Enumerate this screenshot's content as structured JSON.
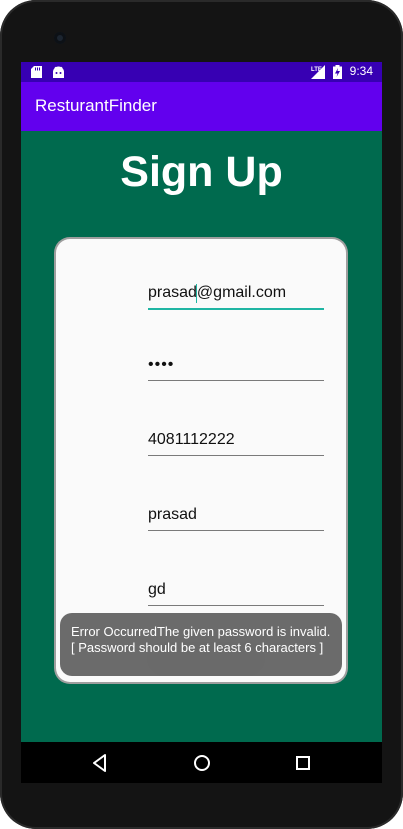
{
  "status_bar": {
    "time": "9:34",
    "network": "LTE",
    "icons": [
      "sd-card-icon",
      "android-icon",
      "lte-signal-icon",
      "battery-charging-icon"
    ]
  },
  "app_bar": {
    "title": "ResturantFinder"
  },
  "page": {
    "title": "Sign Up"
  },
  "form": {
    "fields": [
      {
        "name": "email",
        "value": "prasad@gmail.com",
        "focused": true
      },
      {
        "name": "password",
        "value": "••••",
        "focused": false
      },
      {
        "name": "phone",
        "value": "4081112222",
        "focused": false
      },
      {
        "name": "first-name",
        "value": "prasad",
        "focused": false
      },
      {
        "name": "last-name",
        "value": "gd",
        "focused": false
      }
    ]
  },
  "toast": {
    "message": "Error OccurredThe given password is invalid. [ Password should be at least 6 characters ]"
  },
  "nav_bar": {
    "buttons": [
      "back-icon",
      "home-icon",
      "recents-icon"
    ]
  },
  "colors": {
    "status_bar": "#3700b3",
    "app_bar": "#6200ee",
    "background": "#006a4e",
    "card": "#fafafa",
    "accent": "#1fb5a3",
    "toast": "#666666"
  }
}
